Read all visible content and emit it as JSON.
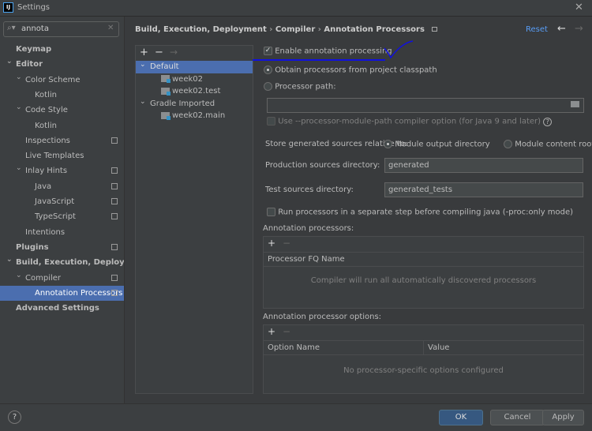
{
  "window": {
    "title": "Settings",
    "logo": "IJ",
    "close_icon": "close-icon"
  },
  "search": {
    "value": "annota"
  },
  "sidebar": {
    "items": [
      {
        "label": "Keymap",
        "bold": true
      },
      {
        "label": "Editor",
        "bold": true
      },
      {
        "label": "Color Scheme"
      },
      {
        "label": "Kotlin"
      },
      {
        "label": "Code Style"
      },
      {
        "label": "Kotlin"
      },
      {
        "label": "Inspections"
      },
      {
        "label": "Live Templates"
      },
      {
        "label": "Inlay Hints"
      },
      {
        "label": "Java"
      },
      {
        "label": "JavaScript"
      },
      {
        "label": "TypeScript"
      },
      {
        "label": "Intentions"
      },
      {
        "label": "Plugins",
        "bold": true
      },
      {
        "label": "Build, Execution, Deployment",
        "bold": true
      },
      {
        "label": "Compiler"
      },
      {
        "label": "Annotation Processors",
        "selected": true
      },
      {
        "label": "Advanced Settings",
        "bold": true
      }
    ]
  },
  "breadcrumb": [
    "Build, Execution, Deployment",
    "Compiler",
    "Annotation Processors"
  ],
  "header": {
    "reset": "Reset"
  },
  "profiles": {
    "tree": [
      {
        "label": "Default",
        "selected": true
      },
      {
        "label": "week02"
      },
      {
        "label": "week02.test"
      },
      {
        "label": "Gradle Imported"
      },
      {
        "label": "week02.main"
      }
    ]
  },
  "settings": {
    "enable": "Enable annotation processing",
    "enable_checked": true,
    "obtain": "Obtain processors from project classpath",
    "processor_path": "Processor path:",
    "processor_path_value": "",
    "module_path": "Use --processor-module-path compiler option (for Java 9 and later)",
    "store_label": "Store generated sources relative to:",
    "store_output": "Module output directory",
    "store_content": "Module content root",
    "prod_label": "Production sources directory:",
    "prod_value": "generated",
    "test_label": "Test sources directory:",
    "test_value": "generated_tests",
    "separate": "Run processors in a separate step before compiling java (-proc:only mode)",
    "processors_label": "Annotation processors:",
    "processors_col": "Processor FQ Name",
    "processors_empty": "Compiler will run all automatically discovered processors",
    "options_label": "Annotation processor options:",
    "options_cols": [
      "Option Name",
      "Value"
    ],
    "options_empty": "No processor-specific options configured"
  },
  "footer": {
    "ok": "OK",
    "cancel": "Cancel",
    "apply": "Apply",
    "help": "?"
  },
  "colors": {
    "accent": "#4b6eaf",
    "annotation_ink": "#1010e0",
    "link": "#589df6"
  }
}
